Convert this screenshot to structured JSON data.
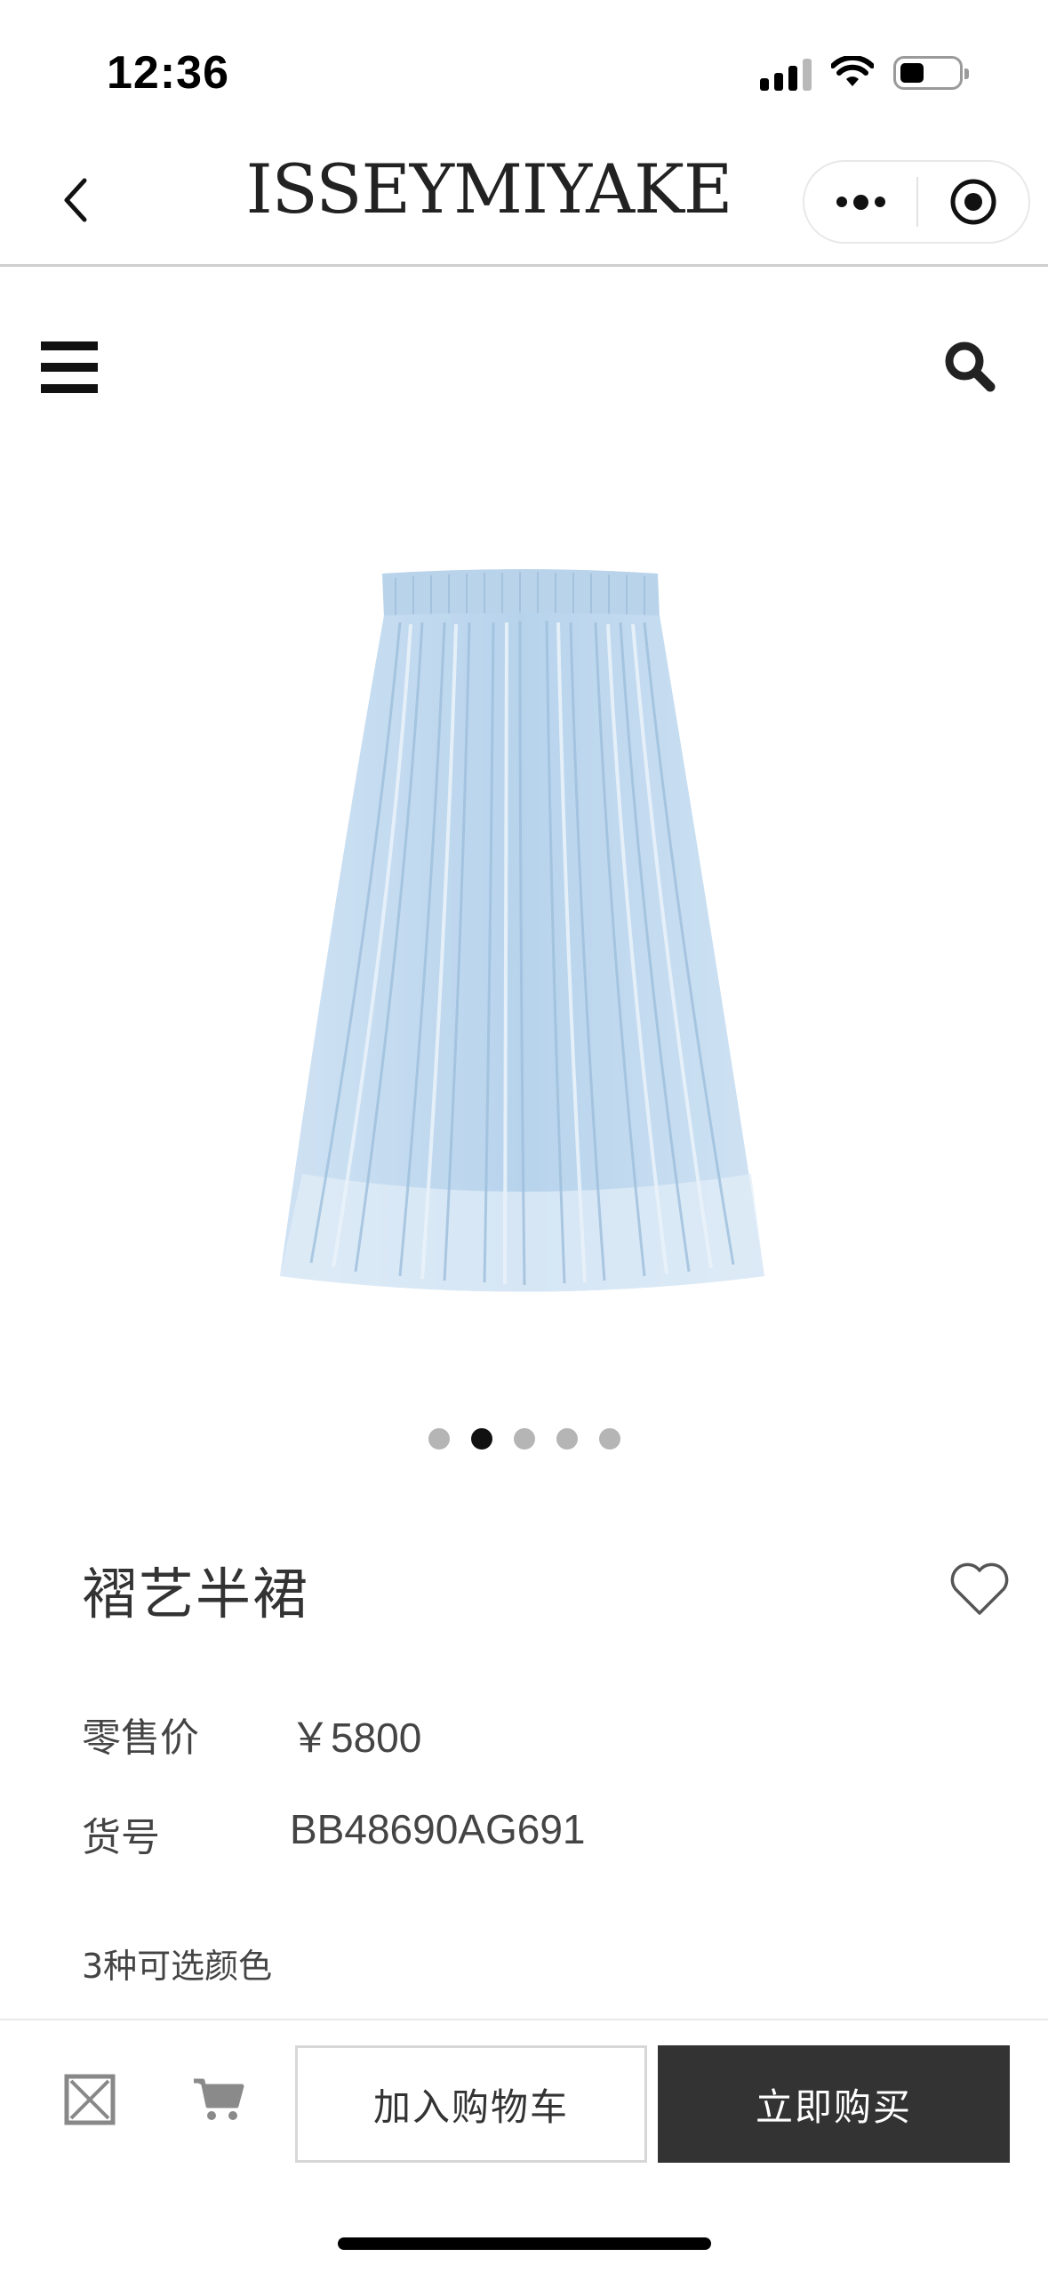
{
  "status_bar": {
    "time": "12:36"
  },
  "nav_bar": {
    "brand": "ISSEYMIYAKE"
  },
  "gallery": {
    "total_pages": 5,
    "active_page": 2
  },
  "product": {
    "title": "褶艺半裙",
    "price_label": "零售价",
    "price_value": "￥5800",
    "sku_label": "货号",
    "sku_value": "BB48690AG691",
    "color_count_text": "3种可选颜色",
    "image_color": "#bcd6ec"
  },
  "actions": {
    "add_to_cart": "加入购物车",
    "buy_now": "立即购买"
  },
  "colors": {
    "accent_dark": "#333333",
    "divider": "#cfcfcf"
  },
  "icons": [
    "back-icon",
    "more-icon",
    "target-icon",
    "menu-icon",
    "search-icon",
    "heart-icon",
    "close-box-icon",
    "cart-icon"
  ]
}
